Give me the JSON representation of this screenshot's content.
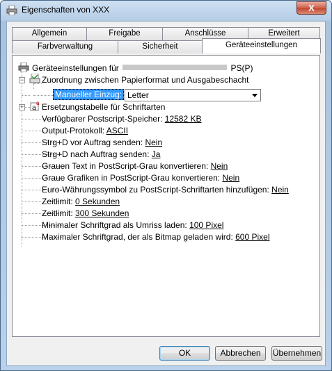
{
  "window": {
    "title": "Eigenschaften von XXX",
    "close_glyph": "X"
  },
  "tabs_row1": [
    {
      "label": "Allgemein"
    },
    {
      "label": "Freigabe"
    },
    {
      "label": "Anschlüsse"
    },
    {
      "label": "Erweitert"
    }
  ],
  "tabs_row2": [
    {
      "label": "Farbverwaltung"
    },
    {
      "label": "Sicherheit"
    },
    {
      "label": "Geräteeinstellungen",
      "active": true
    }
  ],
  "tree": {
    "root": {
      "label_prefix": "Geräteeinstellungen für",
      "label_suffix": "PS(P)",
      "icon": "printer-icon"
    },
    "paper_mapping": {
      "label": "Zuordnung zwischen Papierformat und Ausgabeschacht",
      "icon": "tray-icon"
    },
    "manual_feed": {
      "label": "Manueller Einzug:",
      "value": "Letter"
    },
    "font_substitution": {
      "label": "Ersetzungstabelle für Schriftarten",
      "icon": "font-icon"
    },
    "settings": [
      {
        "label": "Verfügbarer Postscript-Speicher:",
        "value": "12582 KB"
      },
      {
        "label": "Output-Protokoll:",
        "value": "ASCII"
      },
      {
        "label": "Strg+D vor Auftrag senden:",
        "value": "Nein"
      },
      {
        "label": "Strg+D nach Auftrag senden:",
        "value": "Ja"
      },
      {
        "label": "Grauen Text in PostScript-Grau konvertieren:",
        "value": "Nein"
      },
      {
        "label": "Graue Grafiken in PostScript-Grau konvertieren:",
        "value": "Nein"
      },
      {
        "label": "Euro-Währungssymbol zu PostScript-Schriftarten hinzufügen:",
        "value": "Nein"
      },
      {
        "label": "Zeitlimit:",
        "value": "0 Sekunden"
      },
      {
        "label": "Zeitlimit:",
        "value": "300 Sekunden"
      },
      {
        "label": "Minimaler Schriftgrad als Umriss laden:",
        "value": "100 Pixel"
      },
      {
        "label": "Maximaler Schriftgrad, der als Bitmap geladen wird:",
        "value": "600 Pixel"
      }
    ]
  },
  "buttons": {
    "ok": "OK",
    "cancel": "Abbrechen",
    "apply": "Übernehmen"
  },
  "colors": {
    "selection": "#3399ff",
    "close_button": "#c9513b",
    "frame": "#b9d1ea"
  }
}
